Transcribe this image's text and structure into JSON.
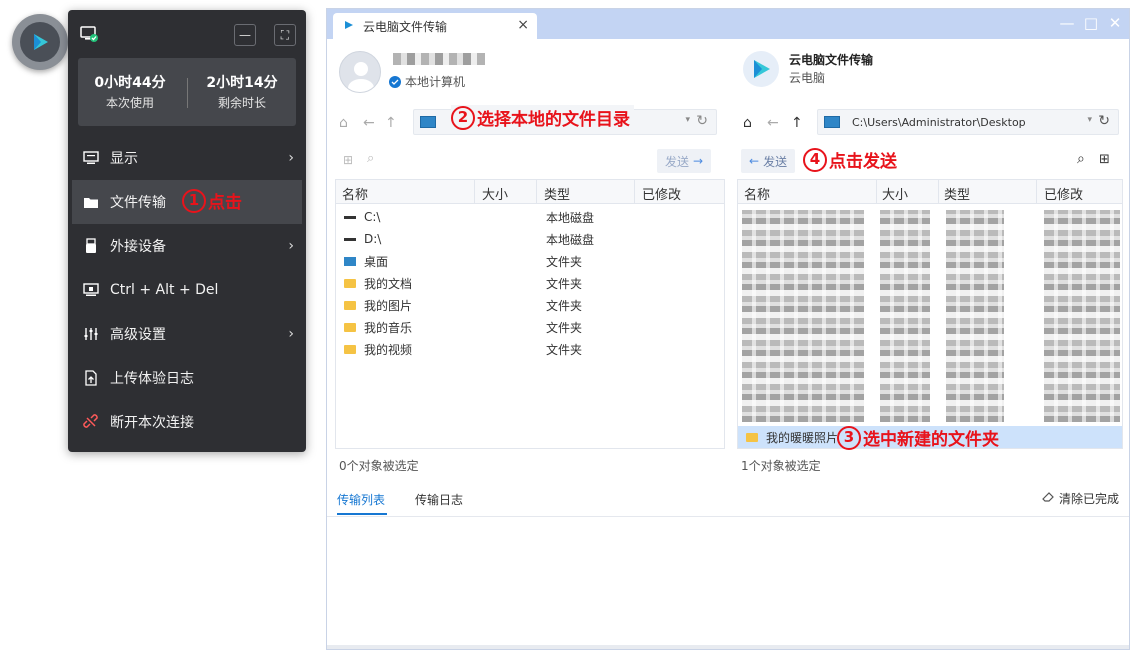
{
  "menu": {
    "usage_used_value": "0小时44分",
    "usage_used_label": "本次使用",
    "usage_remaining_value": "2小时14分",
    "usage_remaining_label": "剩余时长",
    "items": [
      {
        "label": "显示"
      },
      {
        "label": "文件传输"
      },
      {
        "label": "外接设备"
      },
      {
        "label": "Ctrl + Alt + Del"
      },
      {
        "label": "高级设置"
      },
      {
        "label": "上传体验日志"
      },
      {
        "label": "断开本次连接"
      }
    ]
  },
  "annotations": {
    "a1_num": "1",
    "a1_text": "点击",
    "a2_num": "2",
    "a2_text": "选择本地的文件目录",
    "a3_num": "3",
    "a3_text": "选中新建的文件夹",
    "a4_num": "4",
    "a4_text": "点击发送"
  },
  "window": {
    "tab_title": "云电脑文件传输",
    "tab_close": "×",
    "minimize": "—",
    "maximize": "□",
    "close": "✕"
  },
  "local": {
    "computer_label": "本地计算机",
    "address": "",
    "send_label": "发送",
    "columns": [
      "名称",
      "大小",
      "类型",
      "已修改"
    ],
    "rows": [
      {
        "name": "C:\\",
        "type": "本地磁盘",
        "icon": "drive-icon"
      },
      {
        "name": "D:\\",
        "type": "本地磁盘",
        "icon": "drive-icon"
      },
      {
        "name": "桌面",
        "type": "文件夹",
        "icon": "desktop-folder-icon"
      },
      {
        "name": "我的文档",
        "type": "文件夹",
        "icon": "folder-icon"
      },
      {
        "name": "我的图片",
        "type": "文件夹",
        "icon": "folder-icon"
      },
      {
        "name": "我的音乐",
        "type": "文件夹",
        "icon": "folder-icon"
      },
      {
        "name": "我的视频",
        "type": "文件夹",
        "icon": "folder-icon"
      }
    ],
    "status": "0个对象被选定"
  },
  "remote": {
    "title": "云电脑文件传输",
    "subtitle": "云电脑",
    "address": "C:\\Users\\Administrator\\Desktop",
    "send_label": "发送",
    "columns": [
      "名称",
      "大小",
      "类型",
      "已修改"
    ],
    "selected_row": "我的暖暖照片",
    "status": "1个对象被选定"
  },
  "transfer": {
    "tab_list": "传输列表",
    "tab_log": "传输日志",
    "clear_label": "清除已完成"
  },
  "colors": {
    "accent": "#1677d2",
    "annotation": "#e8131b",
    "titlebar": "#c3d4f3",
    "menu_bg": "#2e2f33",
    "selection": "#cde2fb"
  }
}
